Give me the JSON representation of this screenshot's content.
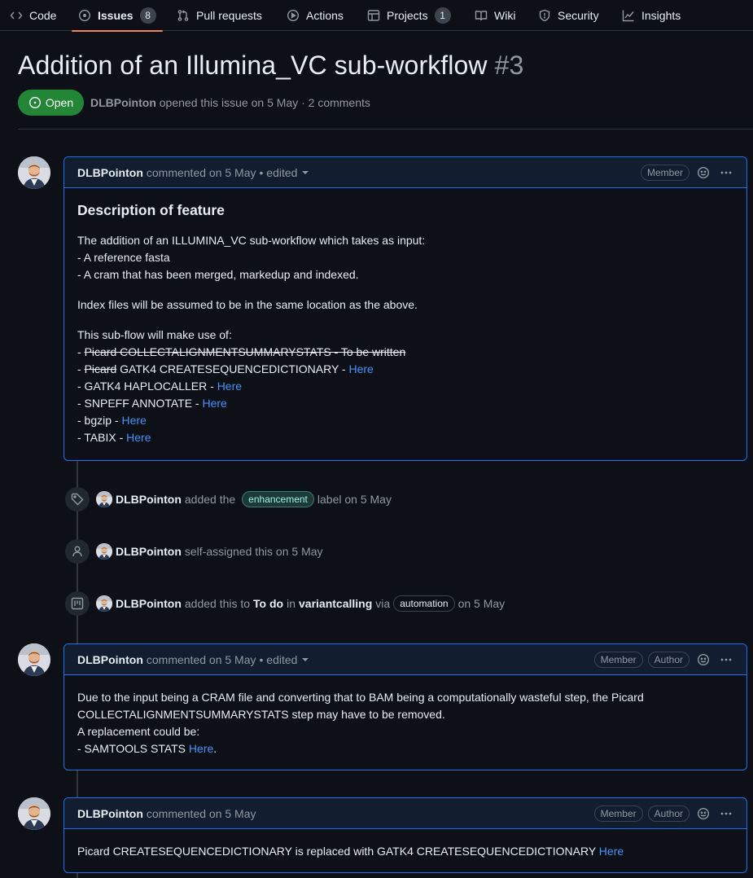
{
  "nav": {
    "tabs": [
      {
        "label": "Code",
        "icon": "code-icon"
      },
      {
        "label": "Issues",
        "icon": "issue-opened-icon",
        "count": "8",
        "active": true
      },
      {
        "label": "Pull requests",
        "icon": "git-pull-request-icon"
      },
      {
        "label": "Actions",
        "icon": "play-icon"
      },
      {
        "label": "Projects",
        "icon": "table-icon",
        "count": "1"
      },
      {
        "label": "Wiki",
        "icon": "book-icon"
      },
      {
        "label": "Security",
        "icon": "shield-icon"
      },
      {
        "label": "Insights",
        "icon": "graph-icon"
      }
    ]
  },
  "issue": {
    "title": "Addition of an Illumina_VC sub-workflow",
    "number": "#3",
    "state": "Open",
    "author": "DLBPointon",
    "meta_rest": "opened this issue on 5 May · 2 comments"
  },
  "comments": [
    {
      "author": "DLBPointon",
      "when": "commented on 5 May",
      "edited": "• edited",
      "badges": [
        "Member"
      ],
      "heading": "Description of feature",
      "p1": [
        "The addition of an ILLUMINA_VC sub-workflow which takes as input:",
        "- A reference fasta",
        "- A cram that has been merged, markedup and indexed."
      ],
      "p2": "Index files will be assumed to be in the same location as the above.",
      "p3_intro": "This sub-flow will make use of:",
      "list": {
        "item1_prefix": "- ",
        "item1_struck": "Picard COLLECTALIGNMENTSUMMARYSTATS - To be written",
        "item2_prefix": "- ",
        "item2_struck": "Picard",
        "item2_text": " GATK4 CREATESEQUENCEDICTIONARY - ",
        "item3_text": "- GATK4 HAPLOCALLER - ",
        "item4_text": "- SNPEFF ANNOTATE - ",
        "item5_text": "- bgzip - ",
        "item6_text": "- TABIX - ",
        "link": "Here"
      }
    },
    {
      "author": "DLBPointon",
      "when": "commented on 5 May",
      "edited": "• edited",
      "badges": [
        "Member",
        "Author"
      ],
      "lines": [
        "Due to the input being a CRAM file and converting that to BAM being a computationally wasteful step, the Picard COLLECTALIGNMENTSUMMARYSTATS step may have to be removed.",
        "A replacement could be:",
        "- SAMTOOLS STATS "
      ],
      "link": "Here",
      "after_link": "."
    },
    {
      "author": "DLBPointon",
      "when": "commented on 5 May",
      "badges": [
        "Member",
        "Author"
      ],
      "text": "Picard CREATESEQUENCEDICTIONARY is replaced with GATK4 CREATESEQUENCEDICTIONARY ",
      "link": "Here"
    }
  ],
  "events": [
    {
      "icon": "tag-icon",
      "actor": "DLBPointon",
      "pre": "added the",
      "label": "enhancement",
      "post": "label on 5 May"
    },
    {
      "icon": "person-icon",
      "actor": "DLBPointon",
      "pre": "self-assigned this on 5 May"
    },
    {
      "icon": "project-icon",
      "actor": "DLBPointon",
      "pre": "added this to",
      "column": "To do",
      "in": "in",
      "project": "variantcalling",
      "via": "via",
      "bot": "automation",
      "post": "on 5 May"
    }
  ],
  "colors": {
    "accent": "#1f6feb",
    "link": "#4493f8",
    "open": "#238636",
    "tab_underline": "#f78166",
    "label_bg": "#1b3a35",
    "label_fg": "#a2eeef"
  }
}
